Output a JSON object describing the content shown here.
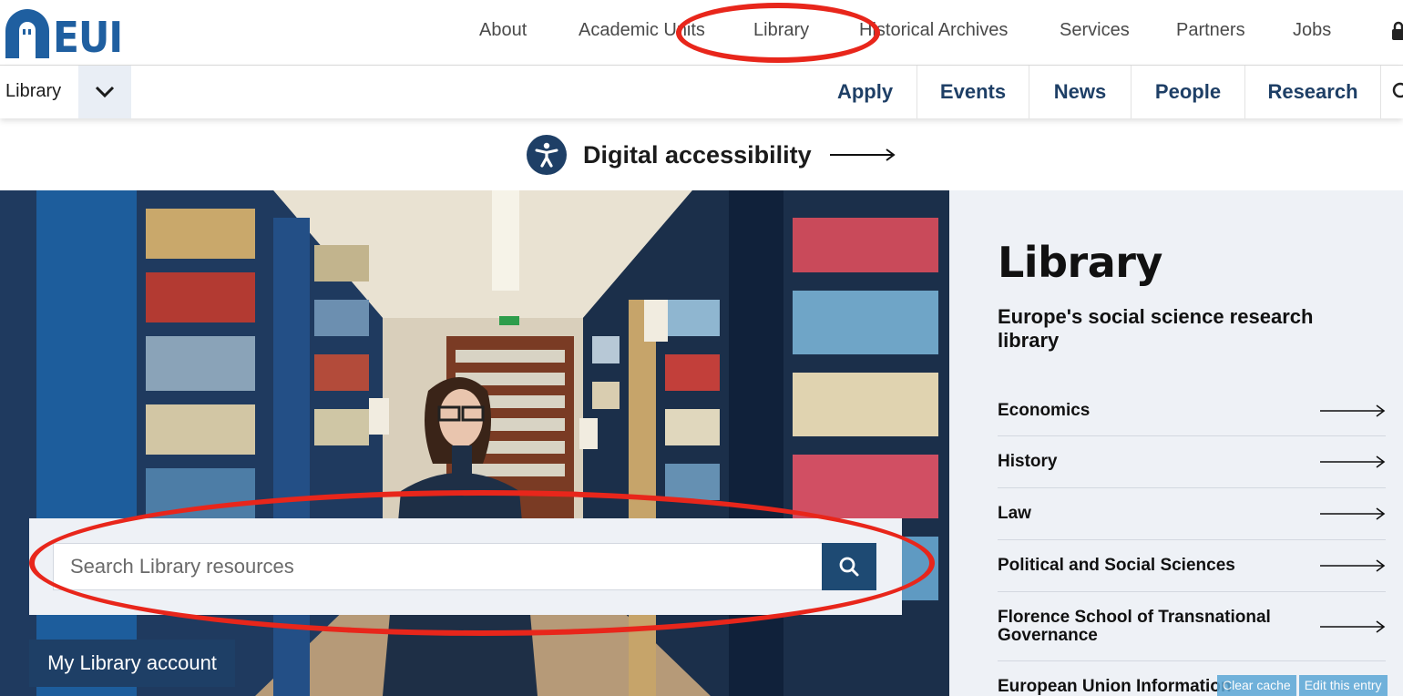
{
  "logo": {
    "text": "EUI"
  },
  "top_nav": {
    "items": [
      {
        "label": "About"
      },
      {
        "label": "Academic Units"
      },
      {
        "label": "Library"
      },
      {
        "label": "Historical Archives"
      },
      {
        "label": "Services"
      },
      {
        "label": "Partners"
      },
      {
        "label": "Jobs"
      }
    ]
  },
  "section_selector": {
    "label": "Library"
  },
  "secondary_nav": {
    "items": [
      {
        "label": "Apply"
      },
      {
        "label": "Events"
      },
      {
        "label": "News"
      },
      {
        "label": "People"
      },
      {
        "label": "Research"
      }
    ]
  },
  "accessibility": {
    "label": "Digital accessibility"
  },
  "search": {
    "placeholder": "Search Library resources"
  },
  "account_button": {
    "label": "My Library account"
  },
  "sidebar": {
    "title": "Library",
    "subtitle": "Europe's social science research library",
    "links": [
      {
        "label": "Economics"
      },
      {
        "label": "History"
      },
      {
        "label": "Law"
      },
      {
        "label": "Political and Social Sciences"
      },
      {
        "label": "Florence School of Transnational Governance"
      },
      {
        "label": "European Union Information"
      }
    ]
  },
  "admin": {
    "clear_cache": "Clear cache",
    "edit_entry": "Edit this entry"
  },
  "colors": {
    "brand_blue": "#1f5fa0",
    "navy": "#1e3f66",
    "annotation_red": "#e8261b",
    "panel_bg": "#eef1f6"
  }
}
